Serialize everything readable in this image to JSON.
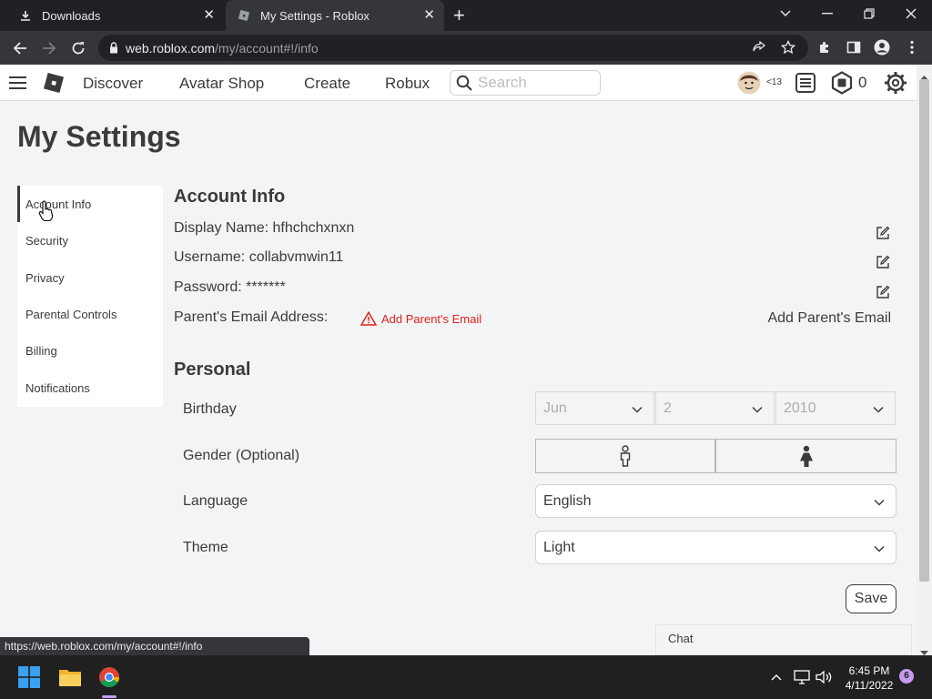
{
  "browser": {
    "tabs": [
      {
        "title": "Downloads",
        "active": false
      },
      {
        "title": "My Settings - Roblox",
        "active": true
      }
    ],
    "address": {
      "host": "web.roblox.com",
      "path": "/my/account#!/info"
    },
    "status_url": "https://web.roblox.com/my/account#!/info"
  },
  "header": {
    "nav": [
      "Discover",
      "Avatar Shop",
      "Create",
      "Robux"
    ],
    "search_placeholder": "Search",
    "age_label": "<13",
    "robux_balance": "0"
  },
  "page": {
    "title": "My Settings",
    "menu": [
      "Account Info",
      "Security",
      "Privacy",
      "Parental Controls",
      "Billing",
      "Notifications"
    ],
    "active_menu": "Account Info"
  },
  "account_info": {
    "heading": "Account Info",
    "display_name_row": "Display Name: hfhchchxnxn",
    "username_row": "Username: collabvmwin11",
    "password_row": "Password: *******",
    "parent_email_label": "Parent's Email Address:",
    "parent_email_warning": "Add Parent's Email",
    "parent_email_button": "Add Parent's Email"
  },
  "personal": {
    "heading": "Personal",
    "birthday_label": "Birthday",
    "birthday": {
      "month": "Jun",
      "day": "2",
      "year": "2010"
    },
    "gender_label": "Gender (Optional)",
    "language_label": "Language",
    "language_value": "English",
    "theme_label": "Theme",
    "theme_value": "Light",
    "save_label": "Save"
  },
  "chat": {
    "label": "Chat"
  },
  "taskbar": {
    "time": "6:45 PM",
    "date": "4/11/2022",
    "notification_count": "6"
  },
  "colors": {
    "warning": "#e2231a",
    "text": "#393b3d",
    "page_bg": "#f2f4f5"
  }
}
